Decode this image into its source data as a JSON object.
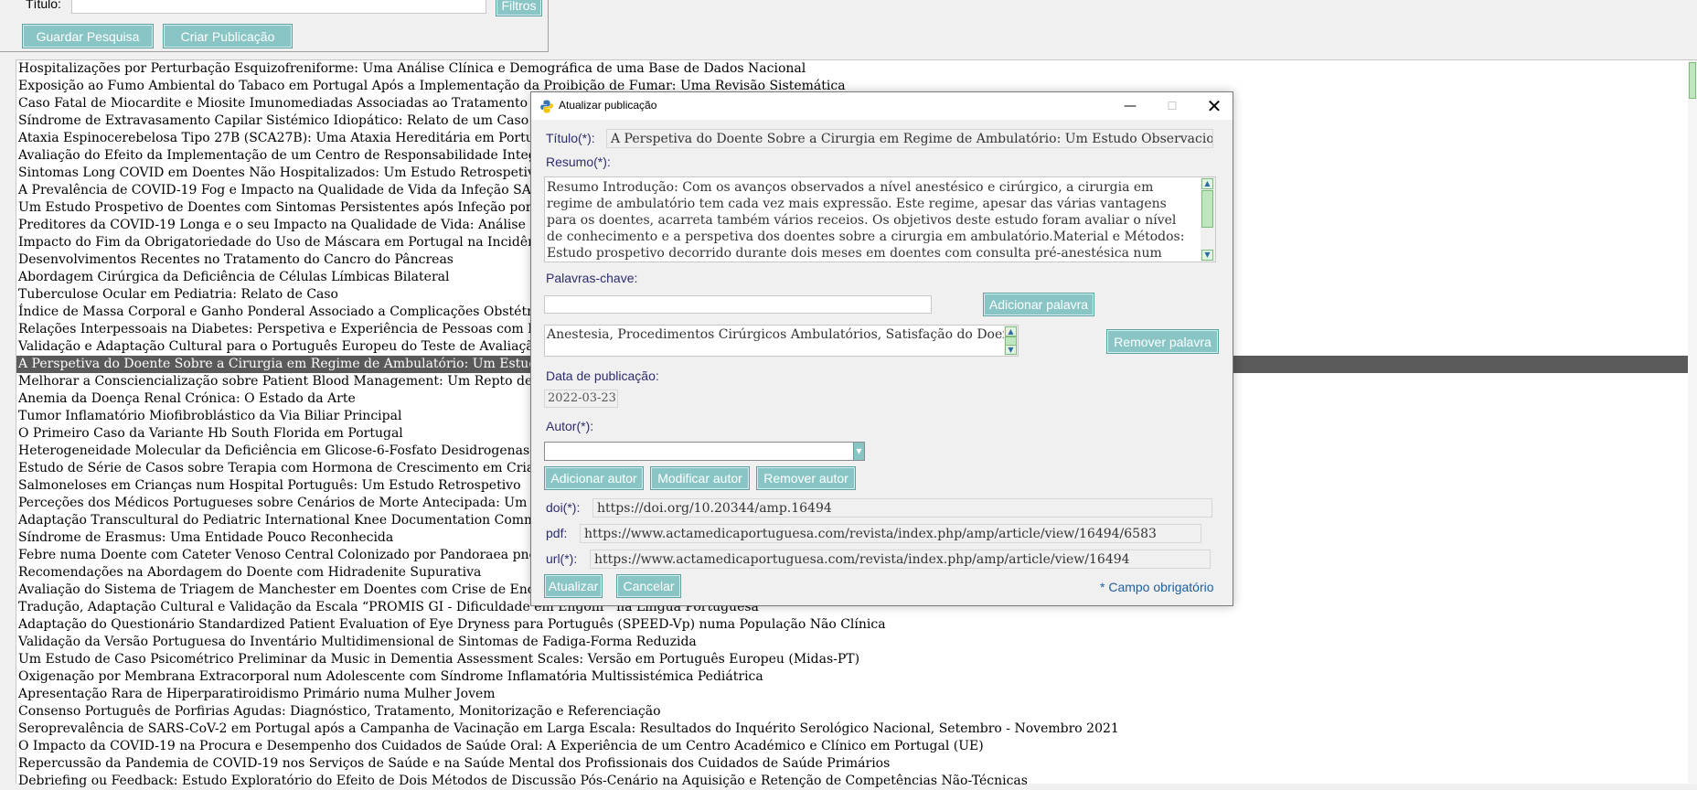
{
  "search": {
    "title_label": "Título:",
    "title_value": "",
    "filters_label": "Filtros",
    "save_search_label": "Guardar Pesquisa",
    "create_publication_label": "Criar Publicação"
  },
  "publications": [
    "Hospitalizações por Perturbação Esquizofreniforme: Uma Análise Clínica e Demográfica de uma Base de Dados Nacional",
    "Exposição ao Fumo Ambiental do Tabaco em Portugal Após a Implementação da Proibição de Fumar: Uma Revisão Sistemática",
    "Caso Fatal de Miocardite e Miosite Imunomediadas Associadas ao Tratamento com I",
    "Síndrome de Extravasamento Capilar Sistémico Idiopático: Relato de um Caso Pediá",
    "Ataxia Espinocerebelosa Tipo 27B (SCA27B): Uma Ataxia Hereditária em Portugal",
    "Avaliação do Efeito da Implementação de um Centro de Responsabilidade Integrado",
    "Sintomas Long COVID em Doentes Não Hospitalizados: Um Estudo Retrospetivo",
    "A Prevalência de COVID-19 Fog e Impacto na Qualidade de Vida da Infeção SARS-C",
    "Um Estudo Prospetivo de Doentes com Sintomas Persistentes após Infeção por SARS",
    "Preditores da COVID-19 Longa e o seu Impacto na Qualidade de Vida: Análise Longi",
    "Impacto do Fim da Obrigatoriedade do Uso de Máscara em Portugal na Incidência e",
    "Desenvolvimentos Recentes no Tratamento do Cancro do Pâncreas",
    "Abordagem Cirúrgica da Deficiência de Células Límbicas Bilateral",
    "Tuberculose Ocular em Pediatria: Relato de Caso",
    "Índice de Massa Corporal e Ganho Ponderal Associado a Complicações Obstétricas e",
    "Relações Interpessoais na Diabetes: Perspetiva e Experiência de Pessoas com Diabete",
    "Validação e Adaptação Cultural para o Português Europeu do Teste de Avaliação da I",
    "A Perspetiva do Doente Sobre a Cirurgia em Regime de Ambulatório: Um Estudo Ob",
    "Melhorar a Consciencialização sobre Patient Blood Management: Um Repto de Açã",
    "Anemia da Doença Renal Crónica: O Estado da Arte",
    "Tumor Inflamatório Miofibroblástico da Via Biliar Principal",
    "O Primeiro Caso da Variante Hb South Florida em Portugal",
    "Heterogeneidade Molecular da Deficiência em Glicose-6-Fosfato Desidrogenase (G6P",
    "Estudo de Série de Casos sobre Terapia com Hormona de Crescimento em Crianças c",
    "Salmoneloses em Crianças num Hospital Português: Um Estudo Retrospetivo",
    "Perceções dos Médicos Portugueses sobre Cenários de Morte Antecipada: Um Estudo",
    "Adaptação Transcultural do Pediatric International Knee Documentation Committee",
    "Síndrome de Erasmus: Uma Entidade Pouco Reconhecida",
    "Febre numa Doente com Cateter Venoso Central Colonizado por Pandoraea pnomen",
    "Recomendações na Abordagem do Doente com Hidradenite Supurativa",
    "Avaliação do Sistema de Triagem de Manchester em Doentes com Crise de Encerram",
    "Tradução, Adaptação Cultural e Validação da Escala “PROMIS GI - Dificuldade em Engolir” na Língua Portuguesa",
    "Adaptação do Questionário Standardized Patient Evaluation of Eye Dryness para Português (SPEED-Vp) numa População Não Clínica",
    "Validação da Versão Portuguesa do Inventário Multidimensional de Sintomas de Fadiga-Forma Reduzida",
    "Um Estudo de Caso Psicométrico Preliminar da Music in Dementia Assessment Scales: Versão em Português Europeu (Midas-PT)",
    "Oxigenação por Membrana Extracorporal num Adolescente com Síndrome Inflamatória Multissistémica Pediátrica",
    "Apresentação Rara de Hiperparatiroidismo Primário numa Mulher Jovem",
    "Consenso Português de Porfirias Agudas: Diagnóstico, Tratamento, Monitorização e Referenciação",
    "Seroprevalência de SARS-CoV-2 em Portugal após a Campanha de Vacinação em Larga Escala: Resultados do Inquérito Serológico Nacional, Setembro - Novembro 2021",
    "O Impacto da COVID-19 na Procura e Desempenho dos Cuidados de Saúde Oral: A Experiência de um Centro Académico e Clínico em Portugal (UE)",
    "Repercussão da Pandemia de COVID-19 nos Serviços de Saúde e na Saúde Mental dos Profissionais dos Cuidados de Saúde Primários",
    "Debriefing ou Feedback: Estudo Exploratório do Efeito de Dois Métodos de Discussão Pós-Cenário na Aquisição e Retenção de Competências Não-Técnicas"
  ],
  "selected_index": 17,
  "dialog": {
    "title": "Atualizar publicação",
    "minimize_glyph": "—",
    "maximize_glyph": "☐",
    "close_glyph": "✕",
    "title_label": "Título(*):",
    "title_value": "A Perspetiva do Doente Sobre a Cirurgia em Regime de Ambulatório: Um Estudo Observacional",
    "abstract_label": "Resumo(*):",
    "abstract_value": "Resumo Introdução: Com os avanços observados a nível anestésico e cirúrgico, a cirurgia em regime de ambulatório tem cada vez mais expressão. Este regime, apesar das várias vantagens para os doentes, acarreta também vários receios. Os objetivos deste estudo foram avaliar o nível de conhecimento e a perspetiva dos doentes sobre a cirurgia em ambulatório.Material e Métodos: Estudo prospetivo decorrido durante dois meses em doentes com consulta pré-anestésica num Centro Hospitalar Universitário. Foi",
    "keywords_label": "Palavras-chave:",
    "keyword_input_value": "",
    "add_keyword_label": "Adicionar palavra",
    "keywords_value": "Anestesia, Procedimentos Cirúrgicos Ambulatórios, Satisfação do Doente",
    "remove_keyword_label": "Remover palavra",
    "date_label": "Data de publicação:",
    "date_value": "2022-03-23",
    "author_label": "Autor(*):",
    "author_value": "",
    "add_author_label": "Adicionar autor",
    "modify_author_label": "Modificar autor",
    "remove_author_label": "Remover autor",
    "doi_label": "doi(*):",
    "doi_value": "https://doi.org/10.20344/amp.16494",
    "pdf_label": "pdf:",
    "pdf_value": "https://www.actamedicaportuguesa.com/revista/index.php/amp/article/view/16494/6583",
    "url_label": "url(*):",
    "url_value": "https://www.actamedicaportuguesa.com/revista/index.php/amp/article/view/16494",
    "update_label": "Atualizar",
    "cancel_label": "Cancelar",
    "required_note": "* Campo obrigatório"
  },
  "colors": {
    "button_bg": "#89c5c5",
    "selected_row": "#5a5a5a",
    "label_text": "#2d2d6e",
    "note_text": "#1f5fa0"
  },
  "icons": {
    "app": "python-logo-icon",
    "scroll_up": "arrow-up-icon",
    "scroll_down": "arrow-down-icon",
    "dropdown": "chevron-down-icon"
  }
}
